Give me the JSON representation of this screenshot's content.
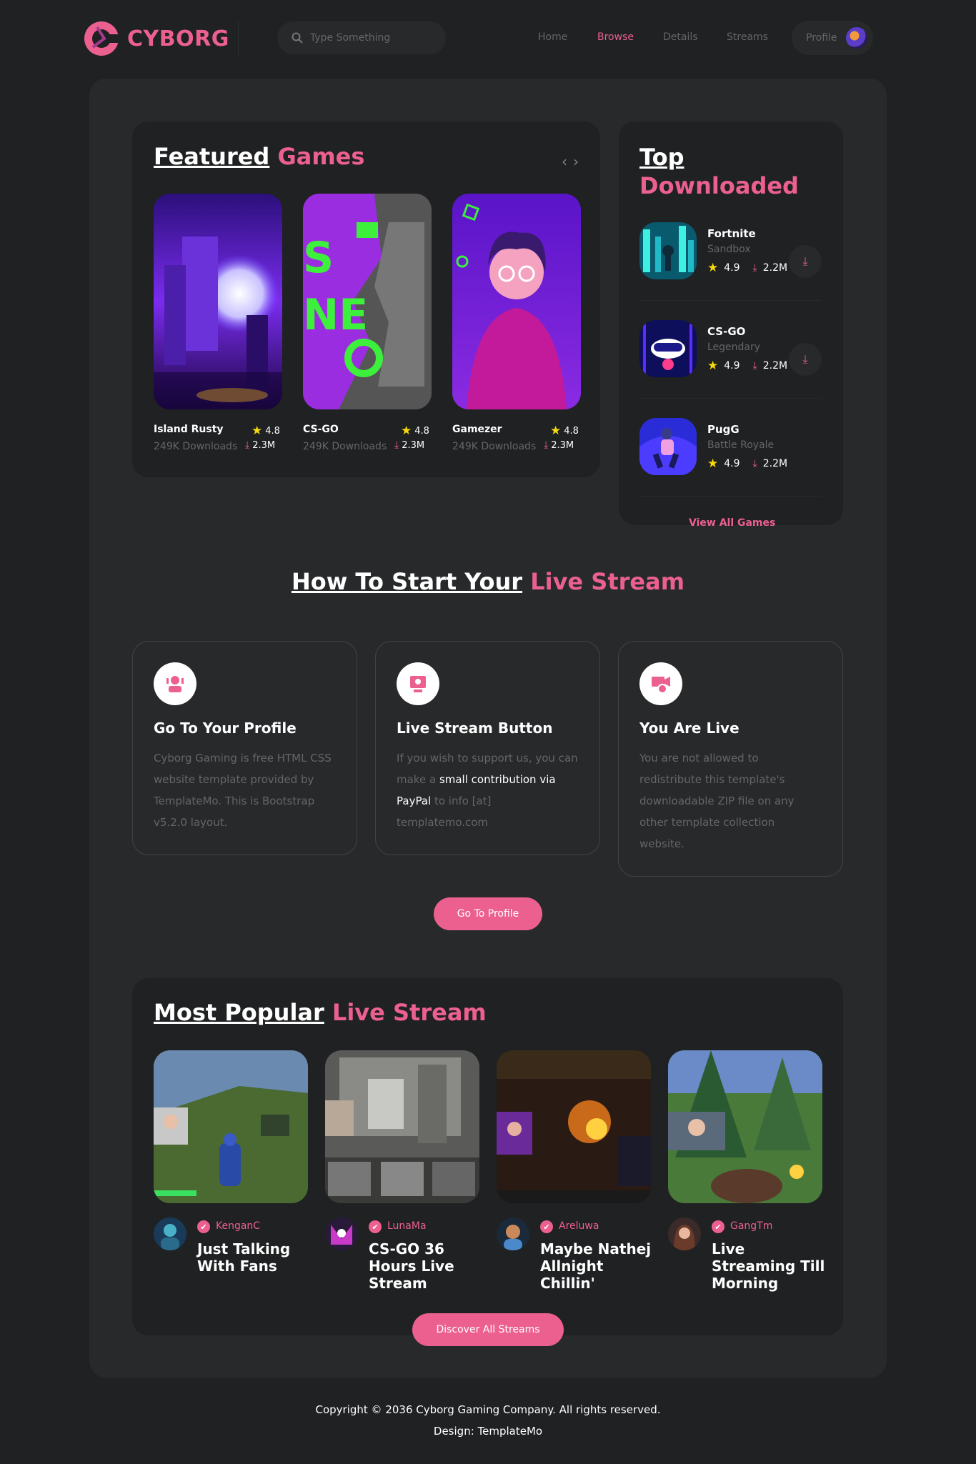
{
  "header": {
    "logo_text": "CYBORG",
    "search_placeholder": "Type Something",
    "nav": [
      "Home",
      "Browse",
      "Details",
      "Streams"
    ],
    "active_nav": "Browse",
    "profile_label": "Profile"
  },
  "featured": {
    "title_white": "Featured",
    "title_pink": "Games",
    "arrows": {
      "prev": "‹",
      "next": "›"
    },
    "games": [
      {
        "name": "Island Rusty",
        "downloads": "249K Downloads",
        "rating": "4.8",
        "count": "2.3M"
      },
      {
        "name": "CS-GO",
        "downloads": "249K Downloads",
        "rating": "4.8",
        "count": "2.3M"
      },
      {
        "name": "Gamezer",
        "downloads": "249K Downloads",
        "rating": "4.8",
        "count": "2.3M"
      }
    ]
  },
  "top_downloaded": {
    "title_white": "Top",
    "title_pink": "Downloaded",
    "items": [
      {
        "name": "Fortnite",
        "category": "Sandbox",
        "rating": "4.9",
        "count": "2.2M"
      },
      {
        "name": "CS-GO",
        "category": "Legendary",
        "rating": "4.9",
        "count": "2.2M"
      },
      {
        "name": "PugG",
        "category": "Battle Royale",
        "rating": "4.9",
        "count": "2.2M"
      }
    ],
    "view_all": "View All Games"
  },
  "how_to": {
    "title_white": "How To Start Your",
    "title_pink": "Live Stream",
    "steps": [
      {
        "title": "Go To Your Profile",
        "text": "Cyborg Gaming is free HTML CSS website template provided by TemplateMo. This is Bootstrap v5.2.0 layout."
      },
      {
        "title": "Live Stream Button",
        "text_a": "If you wish to support us, you can make a",
        "text_b": "small contribution via PayPal",
        "text_c": "to info [at] templatemo.com"
      },
      {
        "title": "You Are Live",
        "text": "You are not allowed to redistribute this template's downloadable ZIP file on any other template collection website."
      }
    ],
    "button": "Go To Profile"
  },
  "popular": {
    "title_white": "Most Popular",
    "title_pink": "Live Stream",
    "streams": [
      {
        "user": "KenganC",
        "title": "Just Talking With Fans"
      },
      {
        "user": "LunaMa",
        "title": "CS-GO 36 Hours Live Stream"
      },
      {
        "user": "Areluwa",
        "title": "Maybe Nathej Allnight Chillin'"
      },
      {
        "user": "GangTm",
        "title": "Live Streaming Till Morning"
      }
    ],
    "button": "Discover All Streams"
  },
  "footer": {
    "copyright": "Copyright © 2036 Cyborg Gaming Company. All rights reserved.",
    "design": "Design: TemplateMo"
  },
  "colors": {
    "accent": "#ec6090",
    "background": "#1f2122",
    "panel": "#27292a"
  }
}
